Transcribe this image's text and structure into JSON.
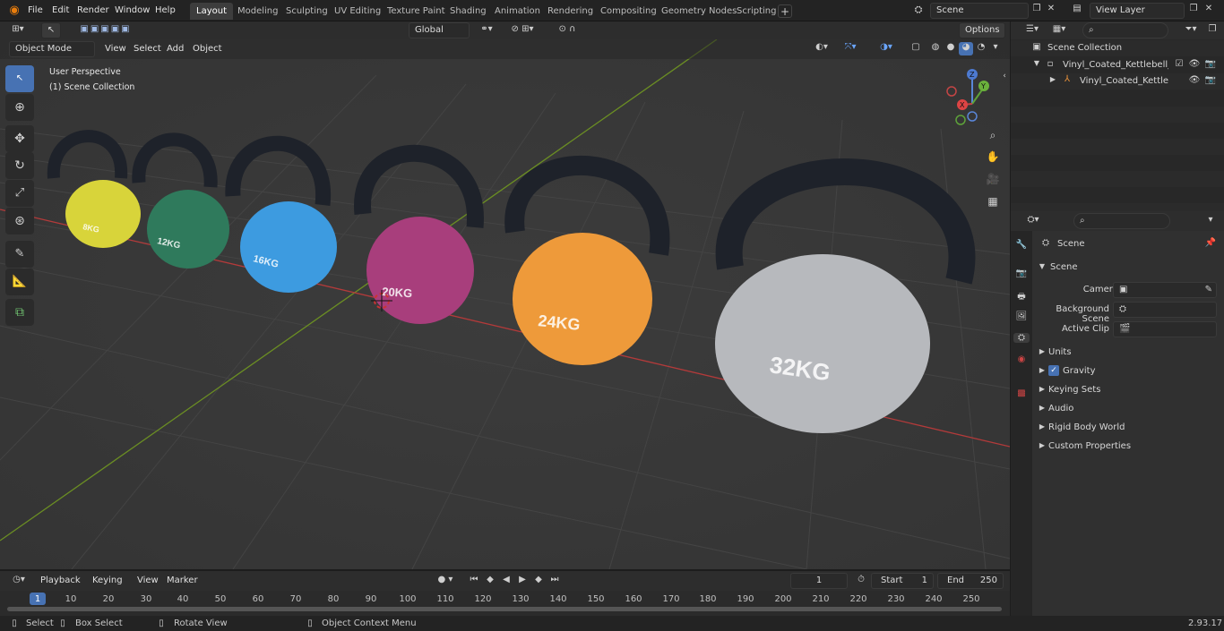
{
  "topbar": {
    "menus": [
      "File",
      "Edit",
      "Render",
      "Window",
      "Help"
    ],
    "workspaces": [
      "Layout",
      "Modeling",
      "Sculpting",
      "UV Editing",
      "Texture Paint",
      "Shading",
      "Animation",
      "Rendering",
      "Compositing",
      "Geometry Nodes",
      "Scripting"
    ],
    "active_workspace": "Layout",
    "scene": "Scene",
    "view_layer": "View Layer"
  },
  "viewport_header": {
    "mode": "Object Mode",
    "menus": [
      "View",
      "Select",
      "Add",
      "Object"
    ],
    "orientation": "Global",
    "options": "Options"
  },
  "viewport": {
    "perspective": "User Perspective",
    "collection": "(1) Scene Collection",
    "kettlebells": [
      {
        "label": "8KG",
        "color": "#d8d43a"
      },
      {
        "label": "12KG",
        "color": "#2f7a5c"
      },
      {
        "label": "16KG",
        "color": "#3d9be0"
      },
      {
        "label": "20KG",
        "color": "#a83e7c"
      },
      {
        "label": "24KG",
        "color": "#ee9a3a"
      },
      {
        "label": "32KG",
        "color": "#b7b9bd"
      }
    ],
    "gizmo_axes": [
      "Z",
      "Y",
      "X"
    ]
  },
  "outliner": {
    "root": "Scene Collection",
    "items": [
      {
        "label": "Vinyl_Coated_Kettlebell_Weig",
        "level": 1
      },
      {
        "label": "Vinyl_Coated_Kettlebell_",
        "level": 2
      }
    ]
  },
  "properties": {
    "title": "Scene",
    "section": "Scene",
    "fields": [
      {
        "label": "Camera"
      },
      {
        "label": "Background Scene"
      },
      {
        "label": "Active Clip"
      }
    ],
    "panels": [
      "Units",
      "Gravity",
      "Keying Sets",
      "Audio",
      "Rigid Body World",
      "Custom Properties"
    ],
    "gravity_checked": true
  },
  "timeline": {
    "menus": [
      "Playback",
      "Keying",
      "View",
      "Marker"
    ],
    "current_frame": "1",
    "start_label": "Start",
    "start": "1",
    "end_label": "End",
    "end": "250",
    "ticks": [
      "1",
      "10",
      "20",
      "30",
      "40",
      "50",
      "60",
      "70",
      "80",
      "90",
      "100",
      "110",
      "120",
      "130",
      "140",
      "150",
      "160",
      "170",
      "180",
      "190",
      "200",
      "210",
      "220",
      "230",
      "240",
      "250"
    ]
  },
  "statusbar": {
    "items": [
      "Select",
      "Box Select",
      "Rotate View",
      "Object Context Menu"
    ],
    "version": "2.93.17"
  }
}
